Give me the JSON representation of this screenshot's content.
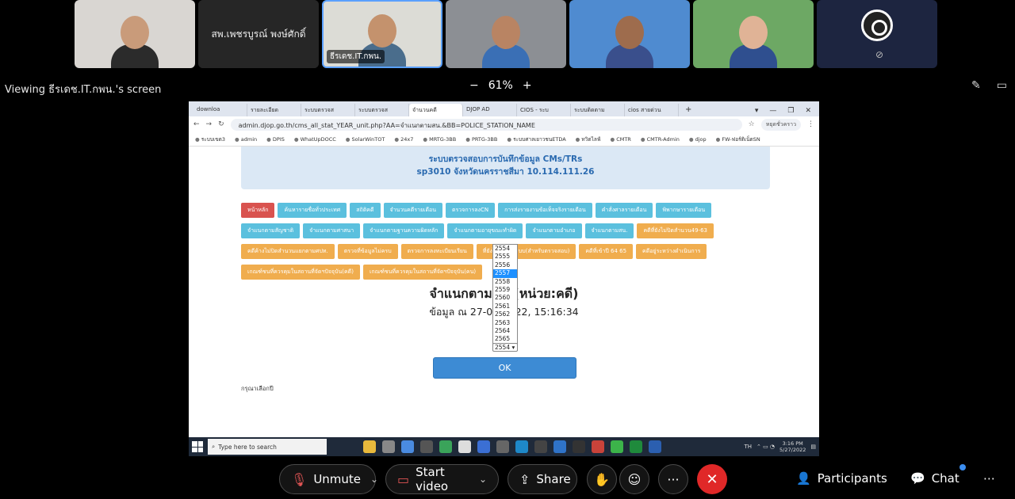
{
  "participants": [
    {
      "label": "",
      "type": "video",
      "bg": "#d9d6d2",
      "skin": "#c99b7a",
      "shirt": "#2b2b2b"
    },
    {
      "label": "สพ.เพชรบูรณ์ พงษ์ศักดิ์",
      "type": "name"
    },
    {
      "label": "ธีรเดช.IT.กพน.",
      "type": "video",
      "bg": "#dcdcd6",
      "skin": "#c4926d",
      "shirt": "#4a6d8c"
    },
    {
      "label": "",
      "type": "video",
      "bg": "#8c8f94",
      "skin": "#b98463",
      "shirt": "#3a6fb5"
    },
    {
      "label": "",
      "type": "video",
      "bg": "#4f8bd0",
      "skin": "#9e6c4d",
      "shirt": "#3a4f8c"
    },
    {
      "label": "",
      "type": "video",
      "bg": "#6da864",
      "skin": "#e0b396",
      "shirt": "#2f4f8f"
    },
    {
      "label": "",
      "type": "obs"
    }
  ],
  "viewbar": {
    "viewing": "Viewing ธีรเดช.IT.กพน.'s screen",
    "zoom": "61%",
    "minus": "−",
    "plus": "+"
  },
  "browser": {
    "tabs": [
      "downloa",
      "รายละเอียด",
      "ระบบตรวจส",
      "ระบบตรวจส",
      "จำนวนคดี",
      "DJOP AD",
      "CIOS - ระบ",
      "ระบบติดตาม",
      "cios สายด่วน"
    ],
    "active_tab": 4,
    "url": "admin.djop.go.th/cms_all_stat_YEAR_unit.php?AA=จำแนกตามสน.&BB=POLICE_STATION_NAME",
    "profile": "หยุดชั่วคราว",
    "bookmarks": [
      "ระบบเขต3",
      "admin",
      "DPIS",
      "WhatUpDOCC",
      "SolarWinTOT",
      "24x7",
      "MRTG-3BB",
      "PRTG-3BB",
      "ระบบศาลเยาวชนETDA",
      "ทวิตไลฟ์",
      "CMTR",
      "CMTR-Admin",
      "djop",
      "FW-ฟอร์ติเน็ตSN"
    ]
  },
  "page": {
    "banner_line1": "ระบบตรวจสอบการบันทึกข้อมูล CMs/TRs",
    "banner_line2": "sp3010 จังหวัดนครราชสีมา 10.114.111.26",
    "row1": [
      {
        "label": "หน้าหลัก",
        "color": "red"
      },
      {
        "label": "ค้นหารายชื่อทั่วประเทศ",
        "color": "blue"
      },
      {
        "label": "สถิติคดี",
        "color": "blue"
      },
      {
        "label": "จำนวนคดีรายเดือน",
        "color": "blue"
      },
      {
        "label": "ตรวจการลงCN",
        "color": "blue"
      },
      {
        "label": "การส่งรายงานข้อเท็จจริงรายเดือน",
        "color": "blue"
      },
      {
        "label": "คำสั่งศาลรายเดือน",
        "color": "blue"
      },
      {
        "label": "พิพากษารายเดือน",
        "color": "blue"
      }
    ],
    "row2": [
      {
        "label": "จำแนกตามสัญชาติ",
        "color": "blue"
      },
      {
        "label": "จำแนกตามศาสนา",
        "color": "blue"
      },
      {
        "label": "จำแนกตามฐานความผิดหลัก",
        "color": "blue"
      },
      {
        "label": "จำแนกตามอายุขณะทำผิด",
        "color": "blue"
      },
      {
        "label": "จำแนกตามอำเภอ",
        "color": "blue"
      },
      {
        "label": "จำแนกตามสน.",
        "color": "blue"
      },
      {
        "label": "คดีที่ยังไม่ปิดสำนวน49-63",
        "color": "orange"
      }
    ],
    "row3": [
      {
        "label": "คดีค้างไม่ปิดสำนวนแยกตามศปท.",
        "color": "orange"
      },
      {
        "label": "ตรวจที่ข้อมูลไม่ครบ",
        "color": "orange"
      },
      {
        "label": "ตรวจการลงทะเบียนเรียน",
        "color": "orange"
      },
      {
        "label": "ที่ยังไม่ปิดในระบบ(สำหรับตรวจสอบ)",
        "color": "orange"
      },
      {
        "label": "คดีที่เข้าปี 64 65",
        "color": "orange"
      },
      {
        "label": "คดีอยู่ระหว่างดำเนินการ",
        "color": "orange"
      }
    ],
    "row4": [
      {
        "label": "เกณฑ์ชนที่ควรคุมในสถานที่จัดฯปัจจุบัน(คดี)",
        "color": "orange"
      },
      {
        "label": "เกณฑ์ชนที่ควรคุมในสถานที่จัดฯปัจจุบัน(คน)",
        "color": "orange"
      }
    ],
    "title": "จำแนกตามสน.(หน่วย:คดี)",
    "subtitle": "ข้อมูล ณ 27-05-2022, 15:16:34",
    "years": [
      "2554",
      "2555",
      "2556",
      "2557",
      "2558",
      "2559",
      "2560",
      "2561",
      "2562",
      "2563",
      "2564",
      "2565"
    ],
    "selected_index": 3,
    "select_value": "2554 ▾",
    "ok_label": "OK",
    "hint": "กรุณาเลือกปี"
  },
  "taskbar": {
    "search_placeholder": "Type here to search",
    "lang": "TH",
    "time": "3:16 PM",
    "date": "5/27/2022"
  },
  "controls": {
    "unmute": "Unmute",
    "start_video": "Start video",
    "share": "Share",
    "participants": "Participants",
    "chat": "Chat",
    "more": "···"
  },
  "colors": {
    "end_call": "#e02828",
    "accent": "#3b8df0"
  }
}
